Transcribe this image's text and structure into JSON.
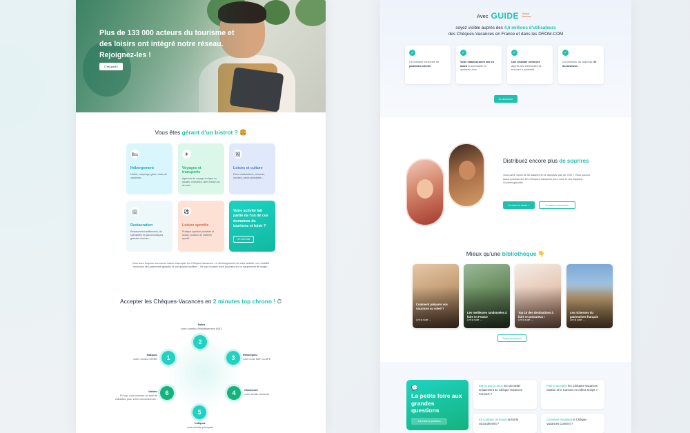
{
  "left_page": {
    "hero": {
      "title": "Plus de 133 000 acteurs du tourisme et des loisirs ont intégré notre réseau. Rejoignez-les !",
      "button": "C'est parti !"
    },
    "gerant_title": {
      "prefix": "Vous êtes ",
      "highlight": "gérant d'un bistrot ?",
      "suffix": " 🍔"
    },
    "categories": [
      {
        "icon": "bed-icon",
        "glyph": "🛏",
        "title": "Hébergement",
        "desc": "Hôtels, campings, gîtes, clubs de vacances..."
      },
      {
        "icon": "plane-icon",
        "glyph": "✈",
        "title": "Voyages et transports",
        "desc": "Agences de voyage en ligne ou locales, croisières, aller d'avion ou de train..."
      },
      {
        "icon": "image-icon",
        "glyph": "🖼",
        "title": "Loisirs et culture",
        "desc": "Parcs d'attractions, cinémas, musées, parcs animaliers..."
      },
      {
        "icon": "building-icon",
        "glyph": "🏢",
        "title": "Restauration",
        "desc": "Restaurants traditionnels, de spécialités et gastronomiques, grandes chaînes..."
      },
      {
        "icon": "ball-icon",
        "glyph": "⚽",
        "title": "Loisirs sportifs",
        "desc": "Pratique sportive (activités et clubs), location de matériel sportif..."
      }
    ],
    "cta_card": {
      "text": "Votre activité fait partie de l'un de ces domaines du tourisme et loisir ?",
      "button": "Je m'en fait"
    },
    "paragraph": "Vous avez toujours une bonne raison d'accepter les Chèques-Vacances. Le développement de votre activité, une visibilité renforcée des paiements garantis et une gestion facilitée... De quoi booster votre business en un claquement de doigts !",
    "accepter_title": {
      "prefix": "Accepter les Chèques-Vacances en ",
      "highlight": "2 minutes top chrono !",
      "suffix": " ⏱"
    },
    "steps": [
      {
        "num": "1",
        "title": "Indiquez",
        "text": "votre numéro SIREN"
      },
      {
        "num": "2",
        "title": "Notez",
        "text": "votre numéro d'établissement (NIC)"
      },
      {
        "num": "3",
        "title": "Renseignez",
        "text": "votre code NAF ou APE"
      },
      {
        "num": "4",
        "title": "Choisissez",
        "text": "votre famille d'activité"
      },
      {
        "num": "5",
        "title": "Indiquez",
        "text": "votre activité principale"
      },
      {
        "num": "6",
        "title": "Validez",
        "text": "Et hop, vous recevez un mail de validation pour votre conventionner !"
      }
    ]
  },
  "right_page": {
    "guide": {
      "avec": "Avec",
      "logo": "GUIDE",
      "logo_sub": "Chèque Vacances",
      "line1_prefix": "soyez visible auprès des ",
      "line1_highlight": "4,6 millions d'utilisateurs",
      "line2": "des Chèques-Vacances en France et dans les DROM-COM"
    },
    "benefits": [
      {
        "text": "Un véritable concentré de ",
        "bold": "potentiels clients"
      },
      {
        "bold": "Votre établissement mis en avant",
        "text": " et accessible en quelques clics"
      },
      {
        "bold": "Une visibilité renforcée",
        "text": " auprès des internautes se trouvant à proximité"
      },
      {
        "text": "Du business, du business, ",
        "bold": "Et du business"
      }
    ],
    "decouvrir_btn": "Je découvre",
    "distrib": {
      "title_prefix": "Distribuez encore plus ",
      "title_highlight": "de sourires",
      "paragraph": "Vous avez moins de 50 salariés et ne disposez pas de CSE ? Vous pouvez aussi commander des Chèques-Vacances pour vous et vos équipes ! Sourires garantis.",
      "btn_primary": "Je veux en savoir +",
      "btn_secondary": "Je passe commande !"
    },
    "biblio_title": {
      "prefix": "Mieux qu'une ",
      "highlight": "bibliothèque",
      "suffix": " 👇"
    },
    "blog_cards": [
      {
        "title": "Comment préparer vos vacances au soleil ?",
        "read": "Lire la suite →"
      },
      {
        "title": "Les meilleures randonnées à faire en France",
        "read": "Lire la suite →"
      },
      {
        "title": "Top 10 des destinations à faire en amoureux !",
        "read": "Lire la suite →"
      },
      {
        "title": "Les richesses du patrimoines français",
        "read": "Lire la suite →"
      }
    ],
    "biblio_btn": "Toutes les lectures",
    "faq": {
      "title": "La petite foire aux grandes questions",
      "button": "J'ai d'autres questions",
      "items": [
        {
          "hl": "Est-ce que je peux",
          "text": " me raccorder uniquement au Chèque-Vacances Connect ?"
        },
        {
          "hl": "Puis-je accepter",
          "text": " les Chèques-Vacances Classic et le Connect en même temps ?"
        },
        {
          "hl": "En combien de temps",
          "text": " se fait le raccordement ?"
        },
        {
          "hl": "Comment encaisser",
          "text": " le Chèque-Vacances Connect ?"
        }
      ]
    }
  },
  "colors": {
    "accent": "#1fc0b0",
    "accent_green": "#13b37e",
    "text": "#1f2d3d"
  }
}
